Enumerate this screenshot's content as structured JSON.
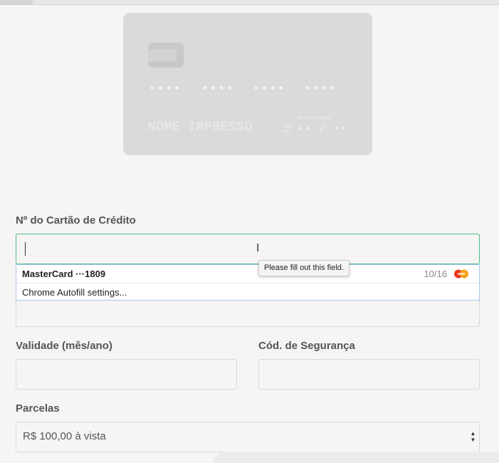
{
  "card_preview": {
    "number_groups": [
      "••••",
      "••••",
      "••••",
      "••••"
    ],
    "name_placeholder": "NOME IMPRESSO",
    "validity_label_top": "MONTH/YEAR",
    "validity_label_side": "valid thru",
    "expiry_placeholder": "•• / ••"
  },
  "form": {
    "card_number_label": "Nº do Cartão de Crédito",
    "validity_label": "Validade (mês/ano)",
    "security_label": "Cód. de Segurança",
    "installments_label": "Parcelas",
    "installments_value": "R$ 100,00 à vista"
  },
  "autofill": {
    "card_label": "MasterCard ···1809",
    "card_expiry": "10/16",
    "settings_label": "Chrome Autofill settings..."
  },
  "tooltip": {
    "message": "Please fill out this field."
  },
  "icons": {
    "card_brand": "mastercard-logo-icon",
    "chip": "card-chip-icon",
    "cursor": "text-cursor-icon",
    "select": "select-arrows-icon"
  },
  "colors": {
    "focus_border": "#4cb88f",
    "autofill_border": "#a9c6ea",
    "card_background": "#dadada"
  }
}
